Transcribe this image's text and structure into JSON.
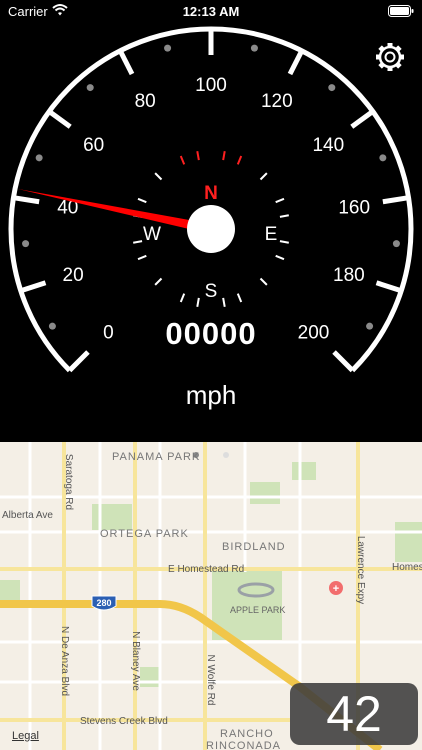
{
  "status_bar": {
    "carrier": "Carrier",
    "time": "12:13 AM"
  },
  "speedometer": {
    "ticks": [
      "0",
      "20",
      "40",
      "60",
      "80",
      "100",
      "120",
      "140",
      "160",
      "180",
      "200"
    ],
    "current_speed": 42,
    "odometer": "00000",
    "unit": "mph",
    "needle_color": "#ff0000"
  },
  "compass": {
    "north": "N",
    "east": "E",
    "south": "S",
    "west": "W",
    "north_color": "#ff2020"
  },
  "map": {
    "labels": {
      "panama_park": "PANAMA PARK",
      "saratoga_rd": "Saratoga Rd",
      "alberta_ave": "Alberta Ave",
      "ortega_park": "ORTEGA PARK",
      "birdland": "BIRDLAND",
      "e_homestead_rd": "E Homestead Rd",
      "homestead": "Homest",
      "lawrence_expy": "Lawrence Expy",
      "highway_shield": "280",
      "apple_park": "APPLE PARK",
      "n_de_anza_blvd": "N De Anza Blvd",
      "n_blaney_ave": "N Blaney Ave",
      "n_wolfe_rd": "N Wolfe Rd",
      "stevens_creek_blvd": "Stevens Creek Blvd",
      "rancho": "RANCHO",
      "rinconada": "RINCONADA"
    },
    "legal": "Legal"
  },
  "speed_display": "42",
  "icons": {
    "settings": "gear-icon",
    "wifi": "wifi-icon",
    "battery": "battery-icon"
  }
}
